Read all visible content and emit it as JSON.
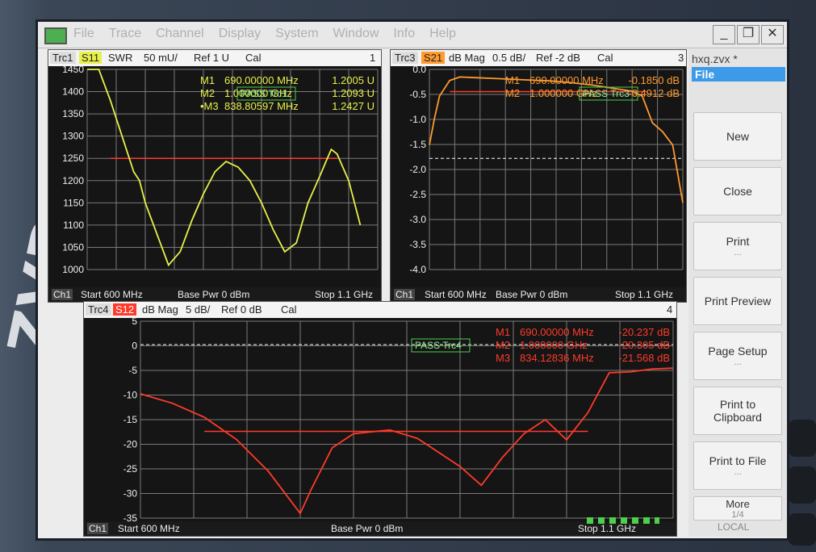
{
  "menubar": {
    "items": [
      "File",
      "Trace",
      "Channel",
      "Display",
      "System",
      "Window",
      "Info",
      "Help"
    ]
  },
  "window_controls": {
    "minimize": "_",
    "restore": "❐",
    "close": "✕"
  },
  "file_name": "hxq.zvx *",
  "softkeys": {
    "title": "File",
    "buttons": [
      {
        "label": "New",
        "sub": ""
      },
      {
        "label": "Close",
        "sub": ""
      },
      {
        "label": "Print",
        "sub": "..."
      },
      {
        "label": "Print Preview",
        "sub": ""
      },
      {
        "label": "Page Setup",
        "sub": "..."
      },
      {
        "label": "Print to Clipboard",
        "sub": ""
      },
      {
        "label": "Print to File",
        "sub": "..."
      },
      {
        "label": "More",
        "sub": "1/4"
      }
    ],
    "status": "LOCAL"
  },
  "brand": "ZVB 8",
  "colors": {
    "s11": "#e8f04a",
    "s21": "#ff9a2e",
    "s12": "#ff3a2a",
    "grid": "#7a7a7a",
    "limit": "#ff3a2a"
  },
  "diagrams": [
    {
      "number": "1",
      "trace": "Trc1",
      "param": "S11",
      "format": "SWR",
      "scale": "50 mU/",
      "ref": "Ref 1 U",
      "cal": "Cal",
      "markers": [
        {
          "name": "M1",
          "x": "690.00000 MHz",
          "y": "1.2005 U"
        },
        {
          "name": "M2",
          "x": "1.000000 GHz",
          "y": "1.2093 U"
        },
        {
          "name": "•M3",
          "x": "838.80597 MHz",
          "y": "1.2427 U"
        }
      ],
      "pass": "PASS Trc1",
      "yticks": [
        "1450",
        "1400",
        "1350",
        "1300",
        "1250",
        "1200",
        "1150",
        "1100",
        "1050",
        "1000"
      ],
      "foot": {
        "ch": "Ch1",
        "start": "Start 600 MHz",
        "pwr": "Base Pwr 0 dBm",
        "stop": "Stop 1.1 GHz"
      }
    },
    {
      "number": "3",
      "trace": "Trc3",
      "param": "S21",
      "format": "dB Mag",
      "scale": "0.5 dB/",
      "ref": "Ref -2 dB",
      "cal": "Cal",
      "markers": [
        {
          "name": "M1",
          "x": "690.00000 MHz",
          "y": "-0.1850 dB"
        },
        {
          "name": "M2",
          "x": "1.000000 GHz",
          "y": "-0.4912 dB"
        }
      ],
      "pass": "PASS Trc3",
      "yticks": [
        "0.0",
        "-0.5",
        "-1.0",
        "-1.5",
        "-2.0",
        "-2.5",
        "-3.0",
        "-3.5",
        "-4.0"
      ],
      "foot": {
        "ch": "Ch1",
        "start": "Start 600 MHz",
        "pwr": "Base Pwr 0 dBm",
        "stop": "Stop 1.1 GHz"
      }
    },
    {
      "number": "4",
      "trace": "Trc4",
      "param": "S12",
      "format": "dB Mag",
      "scale": "5 dB/",
      "ref": "Ref 0 dB",
      "cal": "Cal",
      "markers": [
        {
          "name": "M1",
          "x": "690.00000 MHz",
          "y": "-20.237 dB"
        },
        {
          "name": "M2",
          "x": "1.000000 GHz",
          "y": "-20.305 dB"
        },
        {
          "name": "M3",
          "x": "834.12836 MHz",
          "y": "-21.568 dB"
        }
      ],
      "pass": "PASS Trc4",
      "yticks": [
        "5",
        "0",
        "-5",
        "-10",
        "-15",
        "-20",
        "-25",
        "-30",
        "-35"
      ],
      "foot": {
        "ch": "Ch1",
        "start": "Start 600 MHz",
        "pwr": "Base Pwr 0 dBm",
        "stop": "Stop 1.1 GHz"
      }
    }
  ],
  "chart_data": [
    {
      "type": "line",
      "title": "Trc1 S11 SWR",
      "xlabel": "MHz",
      "ylabel": "mU",
      "xlim": [
        600,
        1100
      ],
      "ylim": [
        1000,
        1450
      ],
      "series": [
        {
          "name": "Trc1",
          "x": [
            600,
            620,
            640,
            660,
            680,
            690,
            700,
            720,
            740,
            760,
            780,
            800,
            820,
            839,
            860,
            880,
            900,
            920,
            940,
            960,
            980,
            1000,
            1010,
            1020,
            1030,
            1050,
            1070
          ],
          "y": [
            1500,
            1450,
            1380,
            1300,
            1220,
            1200,
            1150,
            1080,
            1010,
            1040,
            1110,
            1170,
            1220,
            1243,
            1230,
            1200,
            1150,
            1090,
            1040,
            1060,
            1150,
            1209,
            1240,
            1270,
            1260,
            1200,
            1100
          ]
        }
      ]
    },
    {
      "type": "line",
      "title": "Trc3 S21 dB Mag",
      "xlabel": "MHz",
      "ylabel": "dB",
      "xlim": [
        600,
        1100
      ],
      "ylim": [
        -4.5,
        0.0
      ],
      "series": [
        {
          "name": "Trc3",
          "x": [
            600,
            610,
            620,
            640,
            660,
            690,
            720,
            760,
            800,
            840,
            880,
            920,
            960,
            1000,
            1020,
            1040,
            1060,
            1080,
            1100
          ],
          "y": [
            -1.7,
            -1.1,
            -0.6,
            -0.25,
            -0.17,
            -0.185,
            -0.2,
            -0.22,
            -0.24,
            -0.26,
            -0.3,
            -0.35,
            -0.42,
            -0.49,
            -0.6,
            -1.2,
            -1.4,
            -1.7,
            -3.0
          ]
        }
      ]
    },
    {
      "type": "line",
      "title": "Trc4 S12 dB Mag",
      "xlabel": "MHz",
      "ylabel": "dB",
      "xlim": [
        600,
        1100
      ],
      "ylim": [
        -37,
        5
      ],
      "series": [
        {
          "name": "Trc4",
          "x": [
            600,
            630,
            660,
            690,
            720,
            750,
            760,
            780,
            800,
            834,
            860,
            880,
            900,
            920,
            940,
            960,
            980,
            1000,
            1020,
            1040,
            1060,
            1080,
            1100
          ],
          "y": [
            -10.5,
            -12.5,
            -15.5,
            -20.2,
            -27,
            -36,
            -31,
            -22,
            -19,
            -18.2,
            -20,
            -23,
            -26,
            -30,
            -24,
            -19,
            -16,
            -20.3,
            -14.5,
            -6,
            -5.8,
            -5.2,
            -5
          ]
        }
      ]
    }
  ]
}
